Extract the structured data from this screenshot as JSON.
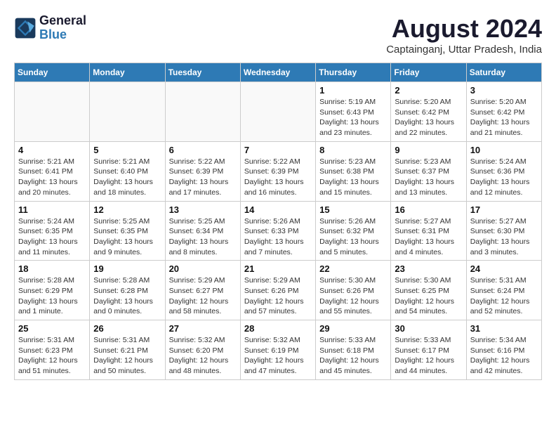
{
  "header": {
    "logo_line1": "General",
    "logo_line2": "Blue",
    "month_year": "August 2024",
    "location": "Captainganj, Uttar Pradesh, India"
  },
  "weekdays": [
    "Sunday",
    "Monday",
    "Tuesday",
    "Wednesday",
    "Thursday",
    "Friday",
    "Saturday"
  ],
  "weeks": [
    [
      {
        "day": "",
        "info": ""
      },
      {
        "day": "",
        "info": ""
      },
      {
        "day": "",
        "info": ""
      },
      {
        "day": "",
        "info": ""
      },
      {
        "day": "1",
        "info": "Sunrise: 5:19 AM\nSunset: 6:43 PM\nDaylight: 13 hours\nand 23 minutes."
      },
      {
        "day": "2",
        "info": "Sunrise: 5:20 AM\nSunset: 6:42 PM\nDaylight: 13 hours\nand 22 minutes."
      },
      {
        "day": "3",
        "info": "Sunrise: 5:20 AM\nSunset: 6:42 PM\nDaylight: 13 hours\nand 21 minutes."
      }
    ],
    [
      {
        "day": "4",
        "info": "Sunrise: 5:21 AM\nSunset: 6:41 PM\nDaylight: 13 hours\nand 20 minutes."
      },
      {
        "day": "5",
        "info": "Sunrise: 5:21 AM\nSunset: 6:40 PM\nDaylight: 13 hours\nand 18 minutes."
      },
      {
        "day": "6",
        "info": "Sunrise: 5:22 AM\nSunset: 6:39 PM\nDaylight: 13 hours\nand 17 minutes."
      },
      {
        "day": "7",
        "info": "Sunrise: 5:22 AM\nSunset: 6:39 PM\nDaylight: 13 hours\nand 16 minutes."
      },
      {
        "day": "8",
        "info": "Sunrise: 5:23 AM\nSunset: 6:38 PM\nDaylight: 13 hours\nand 15 minutes."
      },
      {
        "day": "9",
        "info": "Sunrise: 5:23 AM\nSunset: 6:37 PM\nDaylight: 13 hours\nand 13 minutes."
      },
      {
        "day": "10",
        "info": "Sunrise: 5:24 AM\nSunset: 6:36 PM\nDaylight: 13 hours\nand 12 minutes."
      }
    ],
    [
      {
        "day": "11",
        "info": "Sunrise: 5:24 AM\nSunset: 6:35 PM\nDaylight: 13 hours\nand 11 minutes."
      },
      {
        "day": "12",
        "info": "Sunrise: 5:25 AM\nSunset: 6:35 PM\nDaylight: 13 hours\nand 9 minutes."
      },
      {
        "day": "13",
        "info": "Sunrise: 5:25 AM\nSunset: 6:34 PM\nDaylight: 13 hours\nand 8 minutes."
      },
      {
        "day": "14",
        "info": "Sunrise: 5:26 AM\nSunset: 6:33 PM\nDaylight: 13 hours\nand 7 minutes."
      },
      {
        "day": "15",
        "info": "Sunrise: 5:26 AM\nSunset: 6:32 PM\nDaylight: 13 hours\nand 5 minutes."
      },
      {
        "day": "16",
        "info": "Sunrise: 5:27 AM\nSunset: 6:31 PM\nDaylight: 13 hours\nand 4 minutes."
      },
      {
        "day": "17",
        "info": "Sunrise: 5:27 AM\nSunset: 6:30 PM\nDaylight: 13 hours\nand 3 minutes."
      }
    ],
    [
      {
        "day": "18",
        "info": "Sunrise: 5:28 AM\nSunset: 6:29 PM\nDaylight: 13 hours\nand 1 minute."
      },
      {
        "day": "19",
        "info": "Sunrise: 5:28 AM\nSunset: 6:28 PM\nDaylight: 13 hours\nand 0 minutes."
      },
      {
        "day": "20",
        "info": "Sunrise: 5:29 AM\nSunset: 6:27 PM\nDaylight: 12 hours\nand 58 minutes."
      },
      {
        "day": "21",
        "info": "Sunrise: 5:29 AM\nSunset: 6:26 PM\nDaylight: 12 hours\nand 57 minutes."
      },
      {
        "day": "22",
        "info": "Sunrise: 5:30 AM\nSunset: 6:26 PM\nDaylight: 12 hours\nand 55 minutes."
      },
      {
        "day": "23",
        "info": "Sunrise: 5:30 AM\nSunset: 6:25 PM\nDaylight: 12 hours\nand 54 minutes."
      },
      {
        "day": "24",
        "info": "Sunrise: 5:31 AM\nSunset: 6:24 PM\nDaylight: 12 hours\nand 52 minutes."
      }
    ],
    [
      {
        "day": "25",
        "info": "Sunrise: 5:31 AM\nSunset: 6:23 PM\nDaylight: 12 hours\nand 51 minutes."
      },
      {
        "day": "26",
        "info": "Sunrise: 5:31 AM\nSunset: 6:21 PM\nDaylight: 12 hours\nand 50 minutes."
      },
      {
        "day": "27",
        "info": "Sunrise: 5:32 AM\nSunset: 6:20 PM\nDaylight: 12 hours\nand 48 minutes."
      },
      {
        "day": "28",
        "info": "Sunrise: 5:32 AM\nSunset: 6:19 PM\nDaylight: 12 hours\nand 47 minutes."
      },
      {
        "day": "29",
        "info": "Sunrise: 5:33 AM\nSunset: 6:18 PM\nDaylight: 12 hours\nand 45 minutes."
      },
      {
        "day": "30",
        "info": "Sunrise: 5:33 AM\nSunset: 6:17 PM\nDaylight: 12 hours\nand 44 minutes."
      },
      {
        "day": "31",
        "info": "Sunrise: 5:34 AM\nSunset: 6:16 PM\nDaylight: 12 hours\nand 42 minutes."
      }
    ]
  ]
}
